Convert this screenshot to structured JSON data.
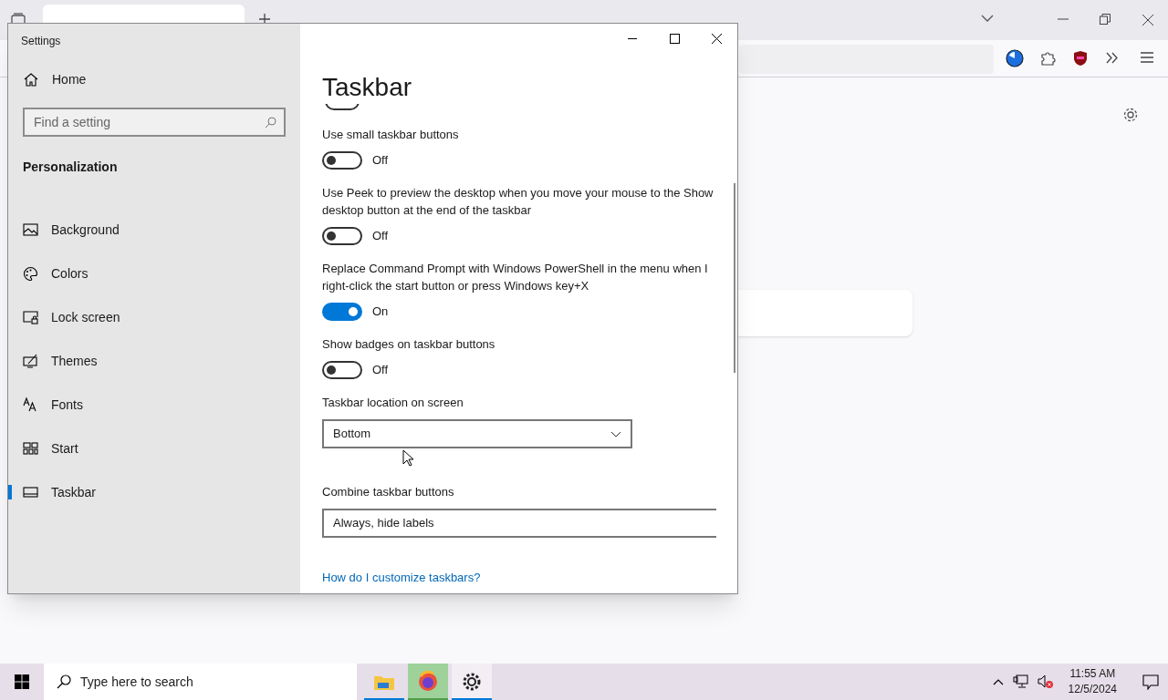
{
  "window": {
    "title": "Settings"
  },
  "sidebar": {
    "home": "Home",
    "search": {
      "placeholder": "Find a setting"
    },
    "section": "Personalization",
    "items": [
      {
        "label": "Background",
        "selected": false
      },
      {
        "label": "Colors",
        "selected": false
      },
      {
        "label": "Lock screen",
        "selected": false
      },
      {
        "label": "Themes",
        "selected": false
      },
      {
        "label": "Fonts",
        "selected": false
      },
      {
        "label": "Start",
        "selected": false
      },
      {
        "label": "Taskbar",
        "selected": true
      }
    ]
  },
  "page": {
    "title": "Taskbar",
    "cut_toggle": {
      "on": false
    },
    "settings": [
      {
        "kind": "toggle",
        "label": "Use small taskbar buttons",
        "on": false,
        "state_text": "Off"
      },
      {
        "kind": "toggle",
        "label": "Use Peek to preview the desktop when you move your mouse to the Show desktop button at the end of the taskbar",
        "on": false,
        "state_text": "Off"
      },
      {
        "kind": "toggle",
        "label": "Replace Command Prompt with Windows PowerShell in the menu when I right-click the start button or press Windows key+X",
        "on": true,
        "state_text": "On"
      },
      {
        "kind": "toggle",
        "label": "Show badges on taskbar buttons",
        "on": false,
        "state_text": "Off"
      },
      {
        "kind": "dropdown",
        "label": "Taskbar location on screen",
        "value": "Bottom"
      },
      {
        "kind": "dropdown",
        "label": "Combine taskbar buttons",
        "value": "Always, hide labels"
      }
    ],
    "link": "How do I customize taskbars?"
  },
  "taskbar": {
    "search": {
      "placeholder": "Type here to search"
    },
    "apps": [
      {
        "selected": false,
        "running": true
      },
      {
        "selected": false,
        "running": true
      },
      {
        "selected": true,
        "running": true
      }
    ],
    "time": "11:55 AM",
    "date": "12/5/2024"
  }
}
